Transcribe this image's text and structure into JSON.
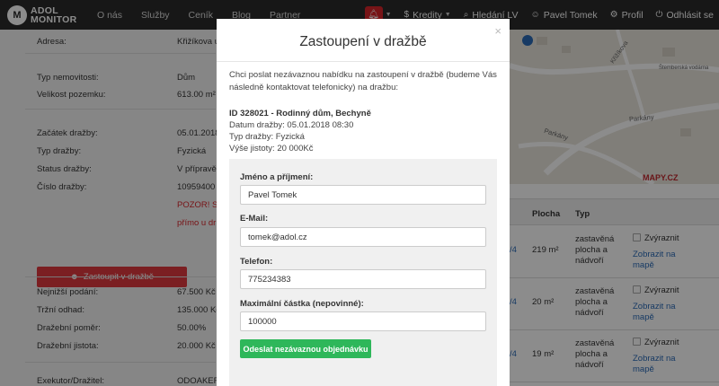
{
  "nav": {
    "logo_line1": "ADOL",
    "logo_line2": "MONITOR",
    "links": [
      "O nás",
      "Služby",
      "Ceník",
      "Blog",
      "Partner"
    ],
    "credits": "Kredity",
    "search_lv": "Hledání LV",
    "user": "Pavel Tomek",
    "profile": "Profil",
    "logout": "Odhlásit se"
  },
  "details": {
    "adresa_label": "Adresa:",
    "adresa_value": "Křižíkova ul.",
    "typ_label": "Typ nemovitosti:",
    "typ_value": "Dům",
    "velikost_label": "Velikost pozemku:",
    "velikost_value": "613.00 m²",
    "zacatek_label": "Začátek dražby:",
    "zacatek_value": "05.01.2018",
    "typ_drazby_label": "Typ dražby:",
    "typ_drazby_value": "Fyzická",
    "status_label": "Status dražby:",
    "status_value": "V přípravě",
    "cislo_label": "Číslo dražby:",
    "cislo_value": "10959400",
    "pozor_text": "POZOR! St",
    "pozor_text2": "přímo u dr",
    "zastoupit_btn": "Zastoupit v dražbě",
    "nejnizsi_label": "Nejnižší podání:",
    "nejnizsi_value": "67.500 Kč",
    "trzni_label": "Tržní odhad:",
    "trzni_value": "135.000 Kč",
    "pomer_label": "Dražební poměr:",
    "pomer_value": "50.00%",
    "jistota_label": "Dražební jistota:",
    "jistota_value": "20.000 Kč",
    "exekutor_label": "Exekutor/Dražitel:",
    "exekutor_value": "ODOAKER a.s."
  },
  "map": {
    "street1": "Křižíkova",
    "street2": "Parkány",
    "street3": "Parkány",
    "street4": "Štemberská vodárna",
    "brand": "MAPY.CZ"
  },
  "table": {
    "headers": [
      "Plocha",
      "Typ"
    ],
    "rows": [
      {
        "plocha": "219 m²",
        "typ": "zastavěná plocha a nádvoří",
        "check": "Zvýraznit",
        "link": "Zobrazit na mapě",
        "frag": "/4"
      },
      {
        "plocha": "20 m²",
        "typ": "zastavěná plocha a nádvoří",
        "check": "Zvýraznit",
        "link": "Zobrazit na mapě",
        "frag": "/4"
      },
      {
        "plocha": "19 m²",
        "typ": "zastavěná plocha a nádvoří",
        "check": "Zvýraznit",
        "link": "Zobrazit na mapě",
        "frag": "/4"
      }
    ]
  },
  "modal": {
    "title": "Zastoupení v dražbě",
    "close": "×",
    "intro": "Chci poslat nezávaznou nabídku na zastoupení v dražbě (budeme Vás následně kontaktovat telefonicky) na dražbu:",
    "auction_id": "ID 328021 - Rodinný dům, Bechyně",
    "date_line": "Datum dražby: 05.01.2018 08:30",
    "type_line": "Typ dražby: Fyzická",
    "deposit_line": "Výše jistoty: 20 000Kč",
    "name_label": "Jméno a příjmení:",
    "name_value": "Pavel Tomek",
    "email_label": "E-Mail:",
    "email_value": "tomek@adol.cz",
    "phone_label": "Telefon:",
    "phone_value": "775234383",
    "amount_label": "Maximální částka (nepovinné):",
    "amount_value": "100000",
    "submit": "Odeslat nezávaznou objednávku"
  },
  "colors": {
    "navbar": "#2b2b2b",
    "accent_red": "#e0393e",
    "submit_green": "#2eb75a",
    "link_blue": "#2a6ab7"
  }
}
